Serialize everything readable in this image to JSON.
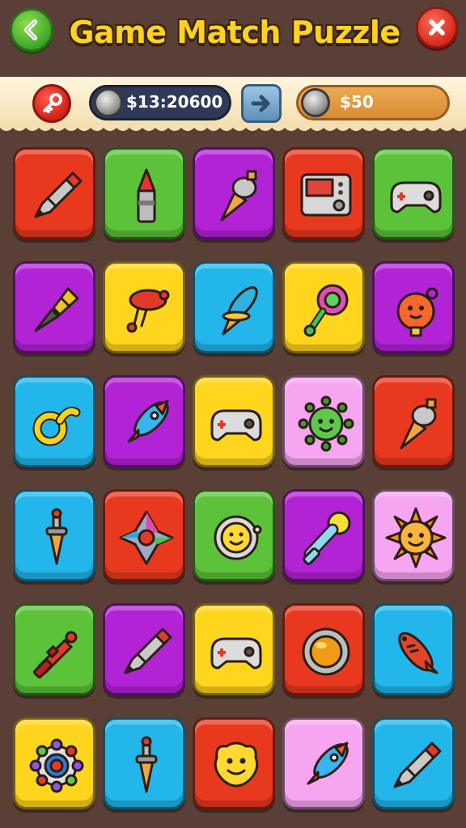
{
  "header": {
    "title": "Game Match Puzzle",
    "back_icon": "chevron-left-icon",
    "close_icon": "close-icon"
  },
  "status": {
    "key_icon": "key-icon",
    "coins": "$13:20600",
    "arrow_icon": "arrow-right-icon",
    "cash": "$50"
  },
  "colors": {
    "red": "#e8391f",
    "green": "#5cc23a",
    "purple": "#b323d6",
    "yellow": "#ffd51e",
    "cyan": "#22b6ea",
    "pink": "#f6a5f0"
  },
  "grid": {
    "rows": 6,
    "cols": 5,
    "tiles": [
      {
        "color": "red",
        "icon": "pencil-icon"
      },
      {
        "color": "green",
        "icon": "crayon-icon"
      },
      {
        "color": "purple",
        "icon": "cone-icon"
      },
      {
        "color": "red",
        "icon": "radio-icon"
      },
      {
        "color": "green",
        "icon": "gamepad-icon"
      },
      {
        "color": "purple",
        "icon": "screwdriver-icon"
      },
      {
        "color": "yellow",
        "icon": "balloon-dog-icon"
      },
      {
        "color": "cyan",
        "icon": "rocket-cone-icon"
      },
      {
        "color": "yellow",
        "icon": "rattle-icon"
      },
      {
        "color": "purple",
        "icon": "ornament-face-icon"
      },
      {
        "color": "cyan",
        "icon": "wrench-ring-icon"
      },
      {
        "color": "purple",
        "icon": "rocket-icon"
      },
      {
        "color": "yellow",
        "icon": "gamepad-icon"
      },
      {
        "color": "pink",
        "icon": "virus-face-icon"
      },
      {
        "color": "red",
        "icon": "cone-icon"
      },
      {
        "color": "cyan",
        "icon": "dagger-icon"
      },
      {
        "color": "red",
        "icon": "spinner-icon"
      },
      {
        "color": "green",
        "icon": "smiley-badge-icon"
      },
      {
        "color": "purple",
        "icon": "bubble-wand-icon"
      },
      {
        "color": "pink",
        "icon": "sun-face-icon"
      },
      {
        "color": "green",
        "icon": "fire-hydrant-icon"
      },
      {
        "color": "purple",
        "icon": "pencil-icon"
      },
      {
        "color": "yellow",
        "icon": "gamepad-icon"
      },
      {
        "color": "red",
        "icon": "porthole-icon"
      },
      {
        "color": "cyan",
        "icon": "rocket-fish-icon"
      },
      {
        "color": "yellow",
        "icon": "spiky-gem-icon"
      },
      {
        "color": "cyan",
        "icon": "dagger-icon"
      },
      {
        "color": "red",
        "icon": "smiley-blob-icon"
      },
      {
        "color": "pink",
        "icon": "rocket-icon"
      },
      {
        "color": "cyan",
        "icon": "pencil-icon"
      }
    ]
  }
}
